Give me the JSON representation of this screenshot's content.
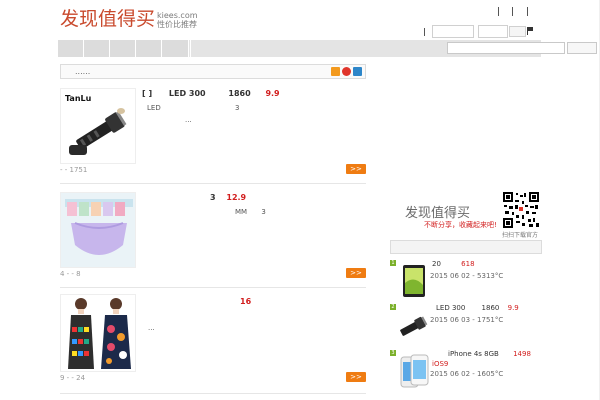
{
  "site": {
    "logo_cn": "发现值得买",
    "logo_domain": "kiees.com",
    "logo_slogan": "性价比推荐"
  },
  "info_bar": {
    "text": "......"
  },
  "deals": [
    {
      "title_left": "[   ]",
      "title_mid": "LED   300",
      "title_num": "1860",
      "price": "9.9",
      "desc_1": "LED",
      "desc_1_num": "3",
      "desc_2": "...",
      "meta": "-      -   1751",
      "button": ">>",
      "thumb_brand": "TanLu"
    },
    {
      "title_num": "3",
      "price": "12.9",
      "desc_1": "MM",
      "desc_1_num": "3",
      "meta": "4   -   -   8",
      "button": ">>"
    },
    {
      "price": "16",
      "desc_1": "...",
      "meta": "9   -   -   24",
      "button": ">>"
    }
  ],
  "sidebar": {
    "logo": "发现值得买",
    "slogan": "不断分享，收藏起来吧!",
    "qr_caption": "扫扫下载官方客户端",
    "items": [
      {
        "rank": "1",
        "title_num": "20",
        "price": "618",
        "date": "2015 06 02  -  5313°C"
      },
      {
        "rank": "2",
        "title_mid": "LED   300",
        "title_num": "1860",
        "price": "9.9",
        "date": "2015 06 03  -  1751°C"
      },
      {
        "rank": "3",
        "title_mid": "iPhone 4s 8GB",
        "price": "1498",
        "sub": "iOS9",
        "date": "2015 06 02  -  1605°C"
      }
    ]
  },
  "colors": {
    "brand_red": "#c94a2d",
    "price_red": "#d21e1e",
    "button_orange": "#ef7c12",
    "rank_green": "#7bb02a"
  }
}
